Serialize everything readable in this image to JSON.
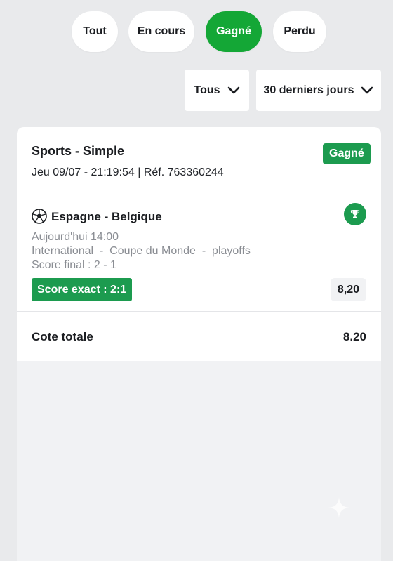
{
  "filters": {
    "status_pills": [
      {
        "label": "Tout",
        "active": false
      },
      {
        "label": "En cours",
        "active": false
      },
      {
        "label": "Gagné",
        "active": true
      },
      {
        "label": "Perdu",
        "active": false
      }
    ],
    "type_dropdown": {
      "value": "Tous"
    },
    "period_dropdown": {
      "value": "30 derniers jours"
    }
  },
  "bet": {
    "title": "Sports - Simple",
    "meta": "Jeu 09/07 - 21:19:54 | Réf. 763360244",
    "status_badge": "Gagné",
    "event": {
      "icon": "soccer-ball-icon",
      "name": "Espagne - Belgique",
      "time": "Aujourd'hui 14:00",
      "competition": "International  -  Coupe du Monde  -  playoffs",
      "final_score": "Score final : 2 - 1",
      "selection": "Score exact : 2:1",
      "odds": "8,20",
      "result_icon": "trophy-icon"
    },
    "total_label": "Cote totale",
    "total_value": "8.20"
  },
  "colors": {
    "background": "#e9eaec",
    "accent_green": "#14a736",
    "badge_green": "#1c9b4f",
    "card_white": "#ffffff",
    "muted_text": "#8a8d93"
  }
}
